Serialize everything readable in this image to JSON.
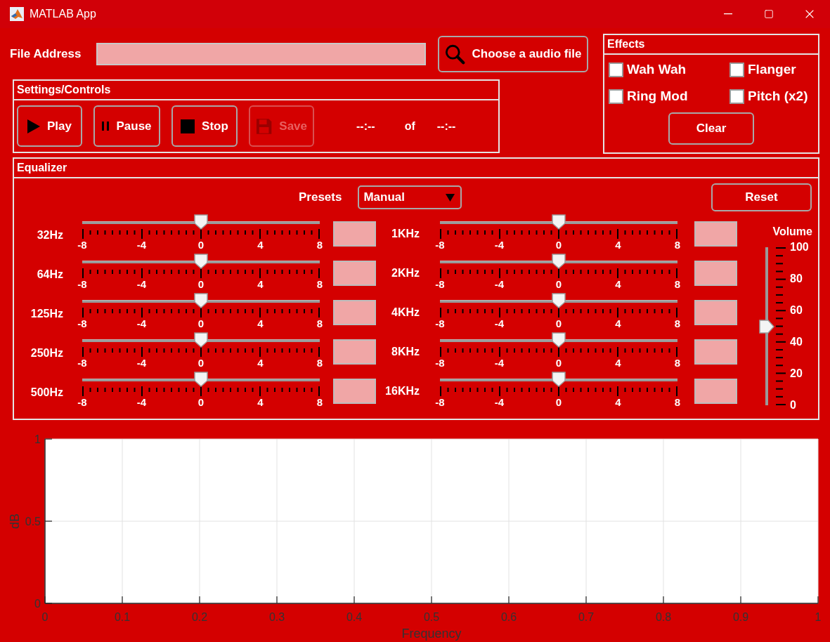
{
  "window": {
    "title": "MATLAB App"
  },
  "file": {
    "label": "File Address",
    "choose_button": "Choose a audio file"
  },
  "settings": {
    "title": "Settings/Controls",
    "buttons": [
      {
        "kind": "play",
        "label": "Play",
        "disabled": false
      },
      {
        "kind": "pause",
        "label": "Pause",
        "disabled": false
      },
      {
        "kind": "stop",
        "label": "Stop",
        "disabled": false
      },
      {
        "kind": "save",
        "label": "Save",
        "disabled": true
      }
    ],
    "time": {
      "current": "--:--",
      "separator": "of",
      "total": "--:--"
    }
  },
  "effects": {
    "title": "Effects",
    "options": [
      {
        "label": "Wah Wah",
        "checked": false
      },
      {
        "label": "Flanger",
        "checked": false
      },
      {
        "label": "Ring Mod",
        "checked": false
      },
      {
        "label": "Pitch (x2)",
        "checked": false
      }
    ],
    "clear_button": "Clear"
  },
  "equalizer": {
    "title": "Equalizer",
    "presets": {
      "label": "Presets",
      "value": "Manual"
    },
    "reset_button": "Reset",
    "left_bands": [
      {
        "label": "32Hz",
        "level": 0.5,
        "ticks": [
          "-8",
          "-4",
          "0",
          "4",
          "8"
        ]
      },
      {
        "label": "64Hz",
        "level": 0.5,
        "ticks": [
          "-8",
          "-4",
          "0",
          "4",
          "8"
        ]
      },
      {
        "label": "125Hz",
        "level": 0.5,
        "ticks": [
          "-8",
          "-4",
          "0",
          "4",
          "8"
        ]
      },
      {
        "label": "250Hz",
        "level": 0.5,
        "ticks": [
          "-8",
          "-4",
          "0",
          "4",
          "8"
        ]
      },
      {
        "label": "500Hz",
        "level": 0.5,
        "ticks": [
          "-8",
          "-4",
          "0",
          "4",
          "8"
        ]
      }
    ],
    "right_bands": [
      {
        "label": "1KHz",
        "level": 0.5,
        "ticks": [
          "-8",
          "-4",
          "0",
          "4",
          "8"
        ]
      },
      {
        "label": "2KHz",
        "level": 0.5,
        "ticks": [
          "-8",
          "-4",
          "0",
          "4",
          "8"
        ]
      },
      {
        "label": "4KHz",
        "level": 0.5,
        "ticks": [
          "-8",
          "-4",
          "0",
          "4",
          "8"
        ]
      },
      {
        "label": "8KHz",
        "level": 0.5,
        "ticks": [
          "-8",
          "-4",
          "0",
          "4",
          "8"
        ]
      },
      {
        "label": "16KHz",
        "level": 0.5,
        "ticks": [
          "-8",
          "-4",
          "0",
          "4",
          "8"
        ]
      }
    ],
    "volume": {
      "label": "Volume",
      "level": 0.5,
      "ticks": [
        "100",
        "80",
        "60",
        "40",
        "20",
        "0"
      ]
    }
  },
  "spectrum": {
    "chart_data": {
      "type": "line",
      "xlabel": "Frequency",
      "ylabel": "dB",
      "xlim": [
        0,
        1
      ],
      "ylim": [
        0,
        1
      ],
      "xticks": [
        0,
        0.1,
        0.2,
        0.3,
        0.4,
        0.5,
        0.6,
        0.7,
        0.8,
        0.9,
        1
      ],
      "yticks": [
        0,
        0.5,
        1
      ],
      "grid": true
    }
  }
}
